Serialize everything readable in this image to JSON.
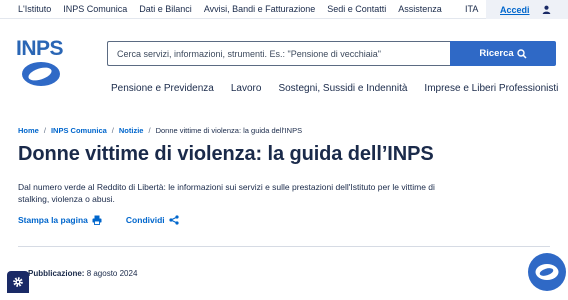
{
  "topbar": {
    "links": [
      "L'Istituto",
      "INPS Comunica",
      "Dati e Bilanci",
      "Avvisi, Bandi e Fatturazione",
      "Sedi e Contatti",
      "Assistenza"
    ],
    "lang": "ITA",
    "login_label": "Accedi"
  },
  "logo": {
    "text": "INPS"
  },
  "search": {
    "placeholder": "Cerca servizi, informazioni, strumenti. Es.: \"Pensione di vecchiaia\"",
    "button_label": "Ricerca"
  },
  "mainnav": [
    "Pensione e Previdenza",
    "Lavoro",
    "Sostegni, Sussidi e Indennità",
    "Imprese e Liberi Professionisti"
  ],
  "breadcrumb": {
    "items": [
      "Home",
      "INPS Comunica",
      "Notizie"
    ],
    "current": "Donne vittime di violenza: la guida dell'INPS",
    "separator": "/"
  },
  "article": {
    "title": "Donne vittime di violenza: la guida dell’INPS",
    "intro": "Dal numero verde al Reddito di Libertà: le informazioni sui servizi e sulle prestazioni dell'Istituto per le vittime di stalking, violenza o abusi.",
    "print_label": "Stampa la pagina",
    "share_label": "Condividi",
    "published_label": "Pubblicazione:",
    "published_date": "8 agosto 2024"
  },
  "colors": {
    "brand": "#2f69c6",
    "link": "#0066cc",
    "text": "#1a2a4a"
  },
  "icons": [
    "user-icon",
    "search-icon",
    "printer-icon",
    "share-icon",
    "gear-icon",
    "chat-icon"
  ]
}
